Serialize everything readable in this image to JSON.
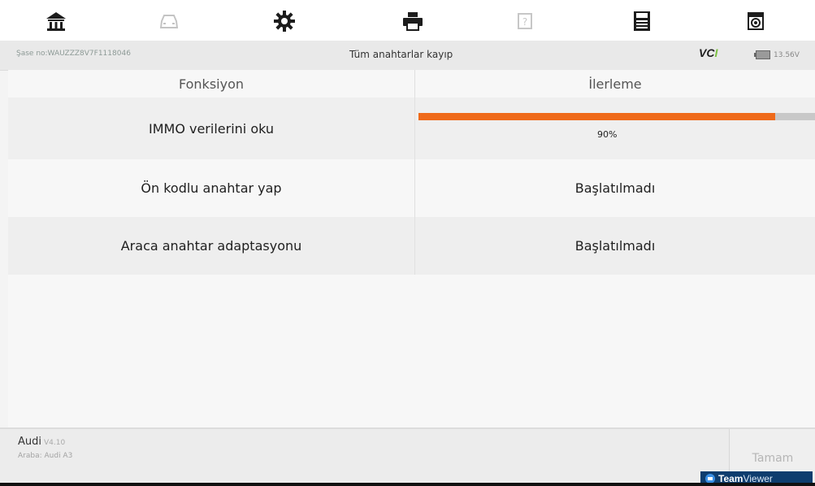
{
  "toolbar": {
    "icons": [
      "home-icon",
      "vehicle-icon",
      "settings-icon",
      "print-icon",
      "help-icon",
      "save-icon",
      "screenshot-icon"
    ]
  },
  "status": {
    "vin": "Şase no:WAUZZZ8V7F1118046",
    "title": "Tüm anahtarlar kayıp",
    "vci_prefix": "VC",
    "vci_suffix": "I",
    "battery": "13.56V"
  },
  "table": {
    "headers": [
      "Fonksiyon",
      "İlerleme"
    ],
    "rows": [
      {
        "function": "IMMO verilerini oku",
        "progress_percent": 90,
        "progress_label": "90%"
      },
      {
        "function": "Ön kodlu anahtar yap",
        "status": "Başlatılmadı"
      },
      {
        "function": "Araca anahtar adaptasyonu",
        "status": "Başlatılmadı"
      }
    ]
  },
  "vehicle": {
    "make": "Audi",
    "version": "V4.10",
    "model": "Araba: Audi A3"
  },
  "buttons": {
    "ok": "Tamam"
  },
  "overlay": {
    "brand_bold": "Team",
    "brand_light": "Viewer"
  },
  "colors": {
    "progress_fill": "#ef6a1a",
    "progress_track": "#c8c8c8",
    "vci_accent": "#7cc142"
  }
}
